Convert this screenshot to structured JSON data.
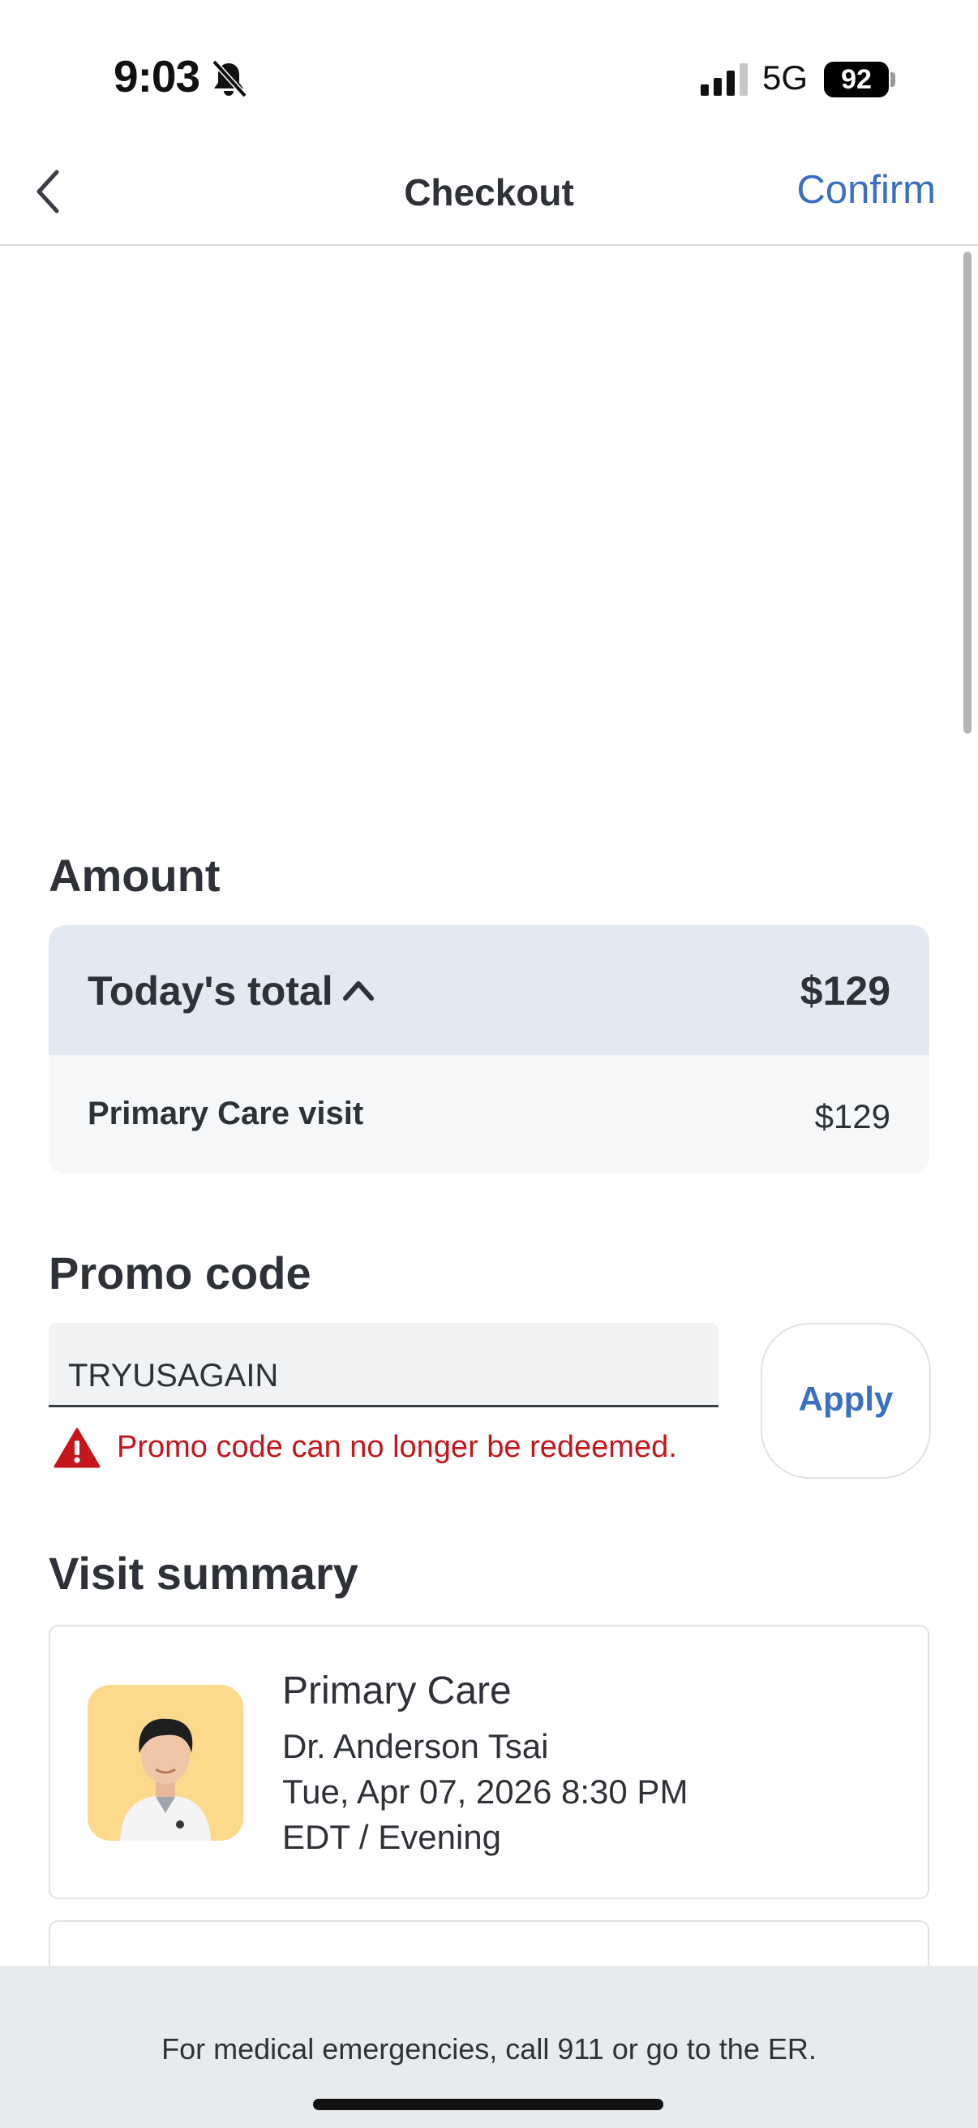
{
  "status_bar": {
    "time": "9:03",
    "network": "5G",
    "battery": "92"
  },
  "nav": {
    "title": "Checkout",
    "confirm_label": "Confirm"
  },
  "amount": {
    "heading": "Amount",
    "total_label": "Today's total",
    "total_value": "$129",
    "items": [
      {
        "label": "Primary Care visit",
        "value": "$129"
      }
    ]
  },
  "promo": {
    "heading": "Promo code",
    "value": "TRYUSAGAIN",
    "apply_label": "Apply",
    "error": "Promo code can no longer be redeemed."
  },
  "visit": {
    "heading": "Visit summary",
    "type": "Primary Care",
    "doctor": "Dr. Anderson Tsai",
    "date": "Tue, Apr 07, 2026 8:30 PM",
    "timezone": "EDT / Evening"
  },
  "footer": {
    "note": "For medical emergencies, call 911 or go to the ER."
  },
  "colors": {
    "accent": "#3b6fc2",
    "error": "#c4161c",
    "total_bg": "#e2e9f3"
  }
}
